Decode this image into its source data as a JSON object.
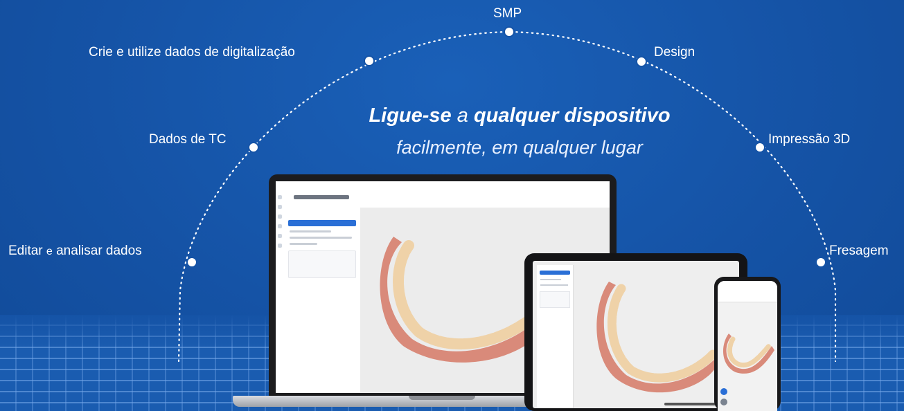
{
  "headline": {
    "line1_bold_a": "Ligue-se",
    "line1_connector": "a",
    "line1_bold_b": "qualquer dispositivo",
    "line2": "facilmente, em qualquer lugar"
  },
  "arc_labels": {
    "smp": "SMP",
    "scan_data": "Crie e utilize dados de digitalização",
    "design": "Design",
    "ct_data": "Dados de TC",
    "print3d": "Impressão 3D",
    "edit_prefix": "Editar",
    "edit_connector": "e",
    "edit_suffix": "analisar dados",
    "milling": "Fresagem"
  },
  "colors": {
    "background": "#1553a6",
    "accent": "#2a6fd6",
    "text": "#ffffff"
  }
}
